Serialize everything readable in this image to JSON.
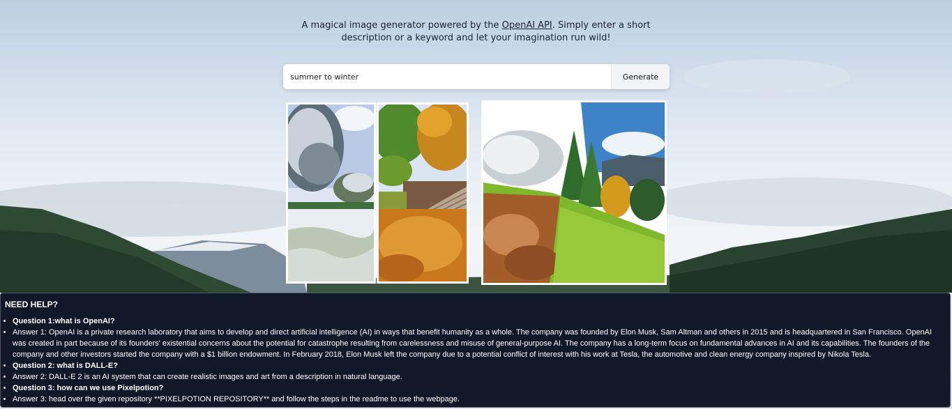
{
  "header": {
    "tagline_before": "A magical image generator powered by the ",
    "tagline_link": "OpenAI API",
    "tagline_after": ". Simply enter a short description or a keyword and let your imagination run wild!"
  },
  "search": {
    "value": "summer to winter",
    "button_label": "Generate"
  },
  "results": {
    "images": [
      {
        "subject": "snowy-garden-trees-image"
      },
      {
        "subject": "autumn-stairs-leaves-image"
      },
      {
        "subject": "winter-autumn-summer-hillside-image"
      }
    ]
  },
  "help": {
    "title": "NEED HELP?",
    "items": [
      {
        "type": "question",
        "text": "Question 1:what is OpenAI?"
      },
      {
        "type": "answer",
        "text": "Answer 1: OpenAI is a private research laboratory that aims to develop and direct artificial intelligence (AI) in ways that benefit humanity as a whole. The company was founded by Elon Musk, Sam Altman and others in 2015 and is headquartered in San Francisco. OpenAI was created in part because of its founders' existential concerns about the potential for catastrophe resulting from carelessness and misuse of general-purpose AI. The company has a long-term focus on fundamental advances in AI and its capabilities. The founders of the company and other investors started the company with a $1 billion endowment. In February 2018, Elon Musk left the company due to a potential conflict of interest with his work at Tesla, the automotive and clean energy company inspired by Nikola Tesla."
      },
      {
        "type": "question",
        "text": "Question 2: what is DALL-E?"
      },
      {
        "type": "answer",
        "text": "Answer 2: DALL-E 2 is an AI system that can create realistic images and art from a description in natural language."
      },
      {
        "type": "question",
        "text": "Question 3: how can we use Pixelpotion?"
      },
      {
        "type": "answer",
        "text": "Answer 3: head over the given repository **PIXELPOTION REPOSITORY** and follow the steps in the readme to use the webpage."
      }
    ]
  }
}
